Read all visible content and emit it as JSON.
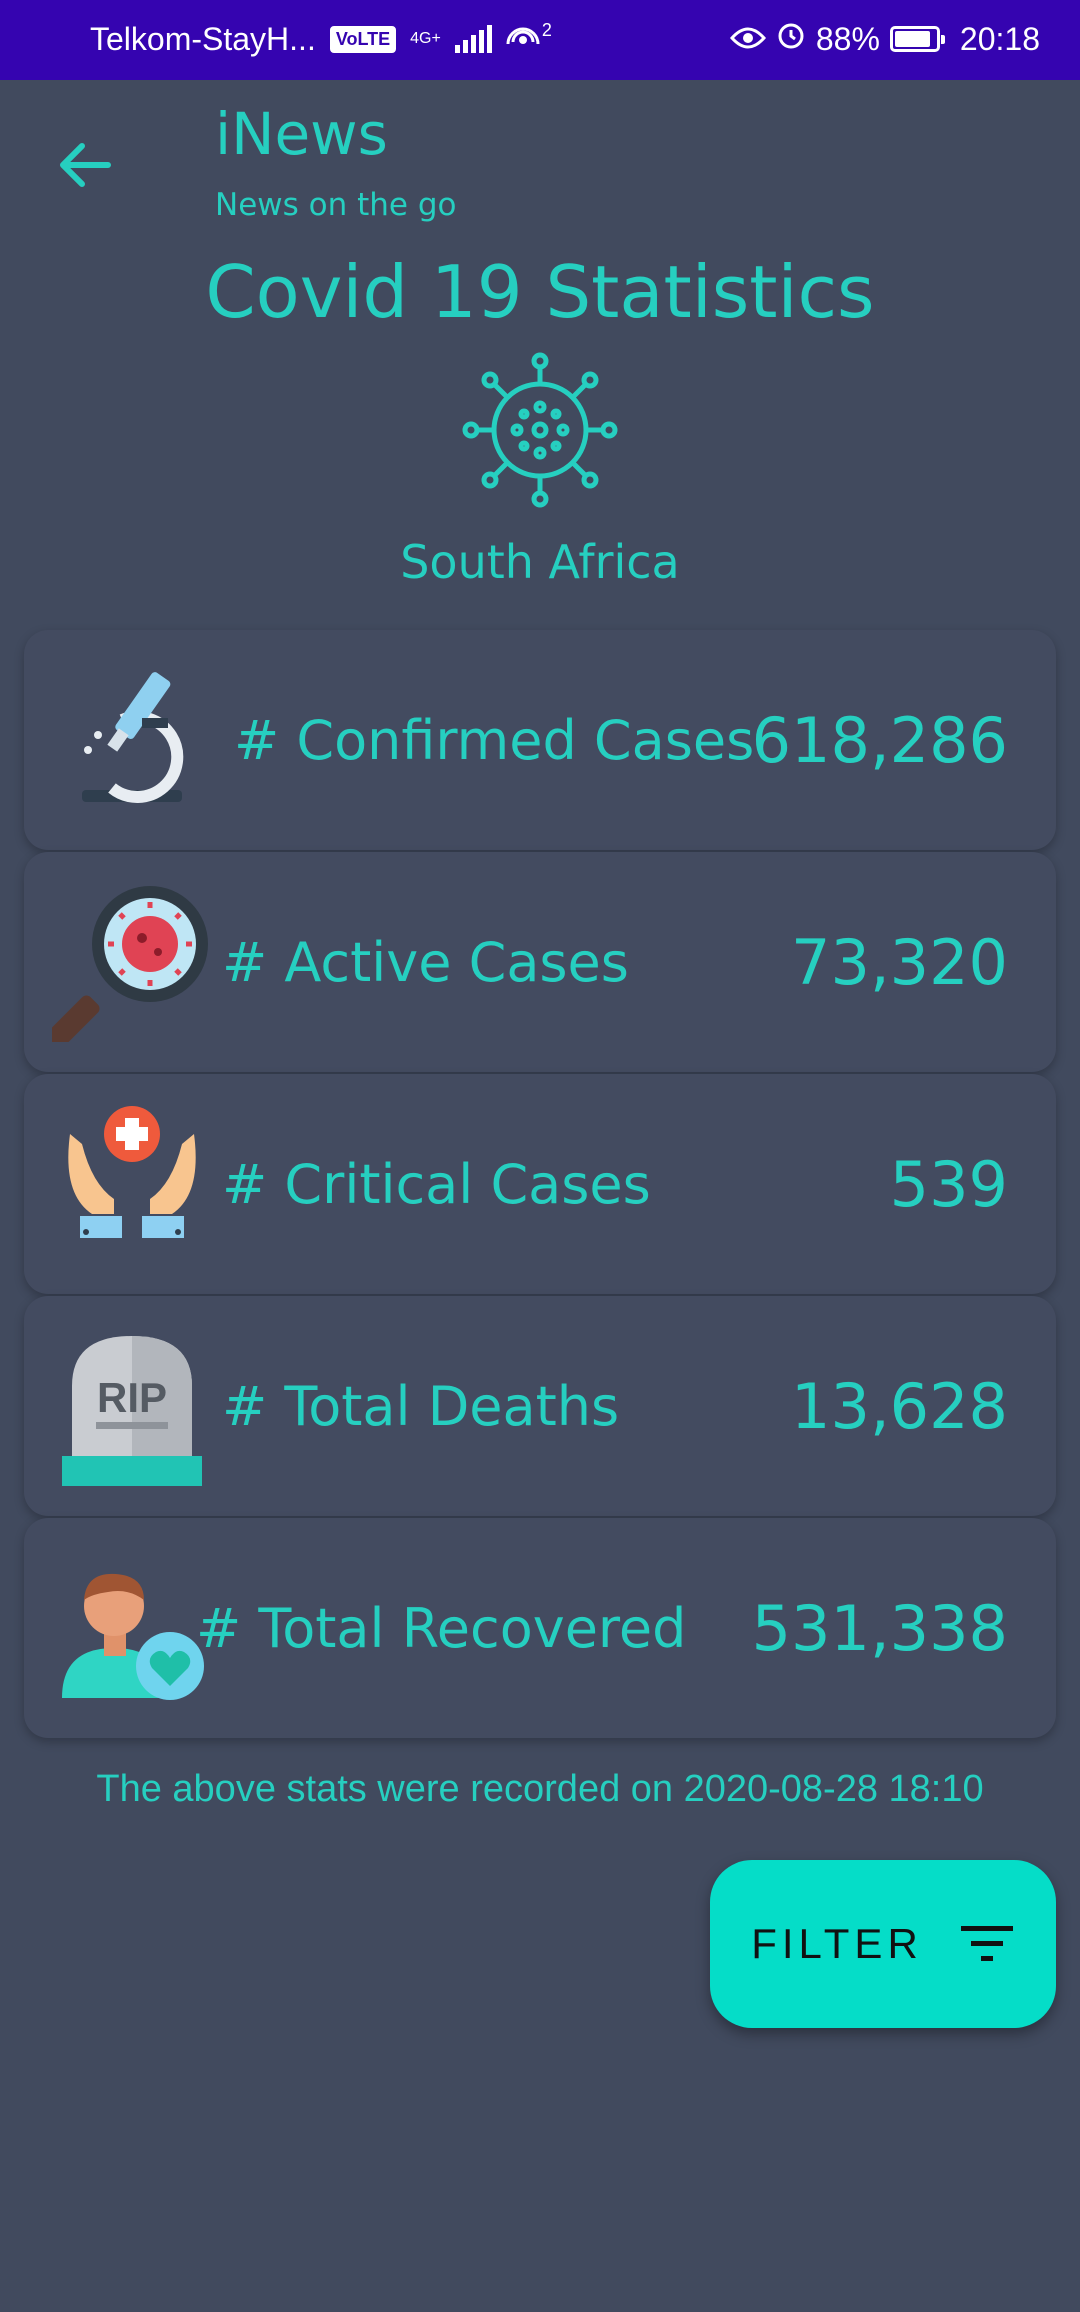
{
  "status_bar": {
    "carrier": "Telkom-StayH...",
    "volte": "VoLTE",
    "network": "4G+",
    "hotspot_count": "2",
    "battery": "88%",
    "time": "20:18"
  },
  "header": {
    "app_title": "iNews",
    "app_subtitle": "News on the go",
    "page_title": "Covid 19 Statistics",
    "country": "South Africa"
  },
  "stats": [
    {
      "label": "# Confirmed Cases",
      "value": "618,286",
      "icon": "microscope-icon"
    },
    {
      "label": "# Active Cases",
      "value": "73,320",
      "icon": "virus-magnifier-icon"
    },
    {
      "label": "# Critical Cases",
      "value": "539",
      "icon": "care-hands-icon"
    },
    {
      "label": "# Total Deaths",
      "value": "13,628",
      "icon": "tombstone-icon"
    },
    {
      "label": "# Total Recovered",
      "value": "531,338",
      "icon": "recovered-person-icon"
    }
  ],
  "footnote": "The above stats were recorded on 2020-08-28 18:10",
  "filter_button": {
    "label": "FILTER",
    "icon": "filter-icon"
  },
  "colors": {
    "accent": "#26cfc0",
    "background": "#414a5e",
    "status_bar": "#3504b0",
    "button": "#05ddc8"
  }
}
